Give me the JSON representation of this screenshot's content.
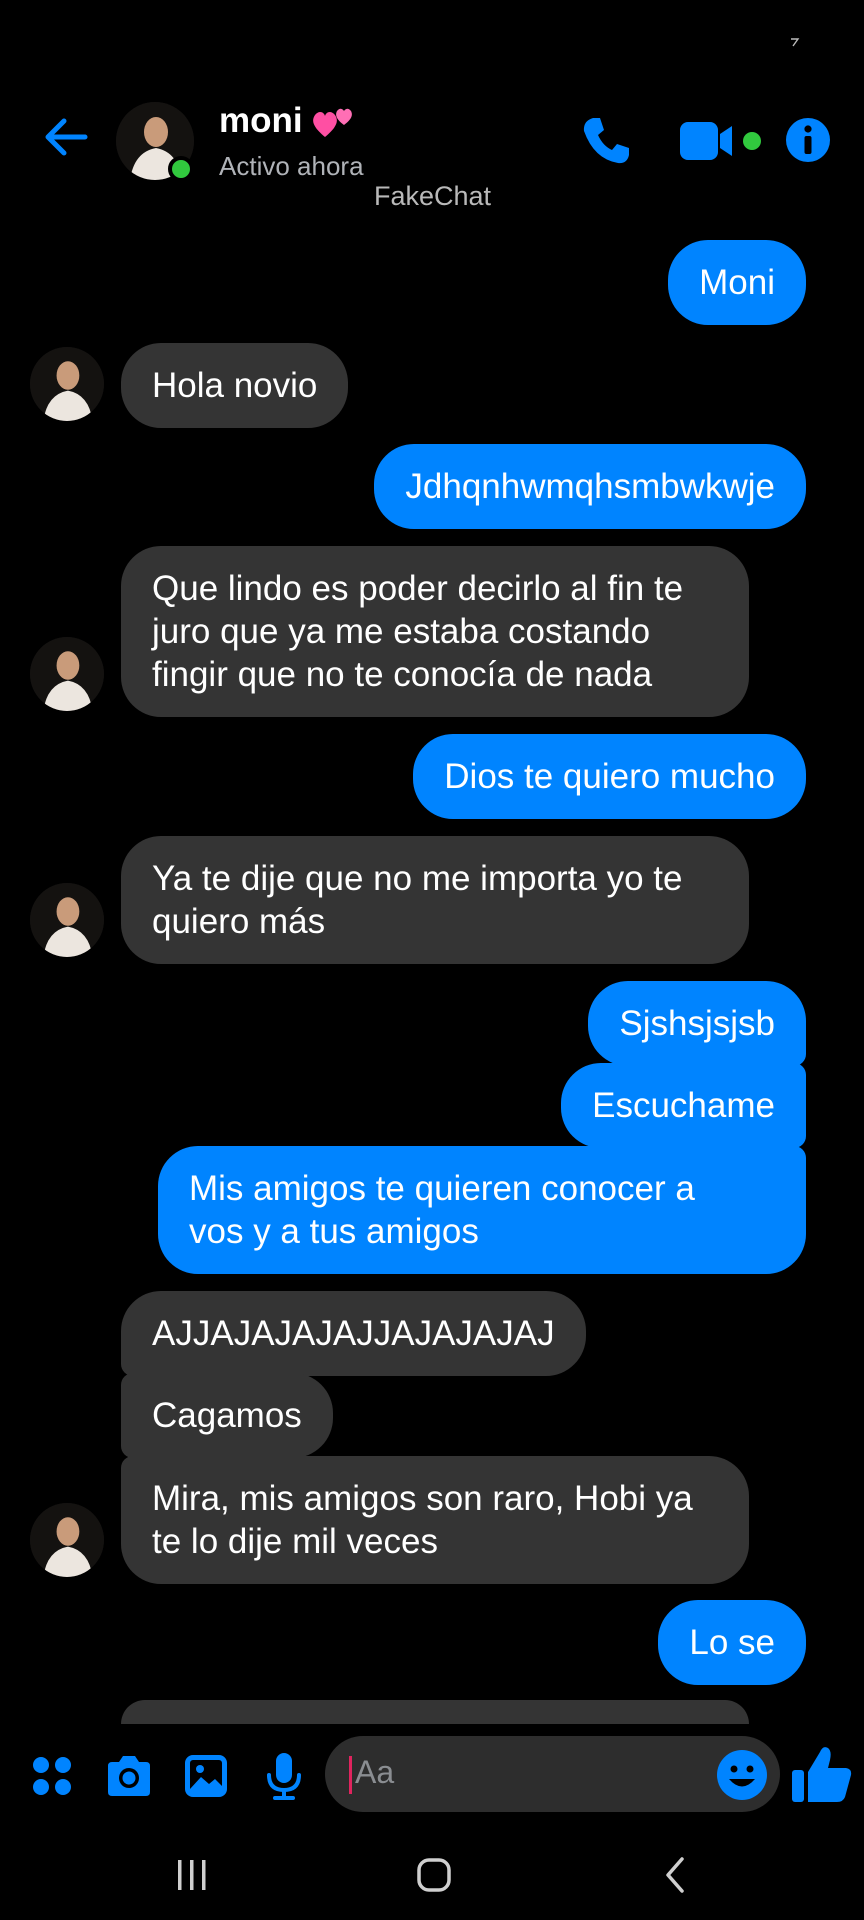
{
  "header": {
    "contact_name": "moni",
    "status": "Activo ahora",
    "watermark": "FakeChat"
  },
  "messages": [
    {
      "side": "sent",
      "text": "Moni"
    },
    {
      "side": "received",
      "text": "Hola novio"
    },
    {
      "side": "sent",
      "text": "Jdhqnhwmqhsmbwkwje"
    },
    {
      "side": "received",
      "text": "Que lindo es poder decirlo al fin te\njuro que ya me estaba costando\nfingir que no te conocía de nada"
    },
    {
      "side": "sent",
      "text": "Dios te quiero mucho"
    },
    {
      "side": "received",
      "text": "Ya te dije que no me importa yo te\nquiero más"
    },
    {
      "side": "sent",
      "text": "Sjshsjsjsb"
    },
    {
      "side": "sent",
      "text": "Escuchame"
    },
    {
      "side": "sent",
      "text": "Mis amigos te quieren conocer a\nvos y a tus amigos"
    },
    {
      "side": "received",
      "text": "AJJAJAJAJAJJAJAJAJAJ"
    },
    {
      "side": "received",
      "text": "Cagamos"
    },
    {
      "side": "received",
      "text": "Mira, mis amigos son raro, Hobi ya\nte lo dije mil veces"
    },
    {
      "side": "sent",
      "text": "Lo se"
    }
  ],
  "composer": {
    "placeholder": "Aa"
  },
  "colors": {
    "accent": "#0084ff",
    "received_bubble": "#343434",
    "online": "#31c93e",
    "background": "#000000"
  },
  "icons": {
    "back": "arrow-left-icon",
    "call": "phone-icon",
    "video": "video-camera-icon",
    "info": "info-icon",
    "menu": "grid-dots-icon",
    "camera": "camera-icon",
    "gallery": "image-icon",
    "mic": "microphone-icon",
    "emoji": "emoji-icon",
    "like": "thumbs-up-icon"
  }
}
